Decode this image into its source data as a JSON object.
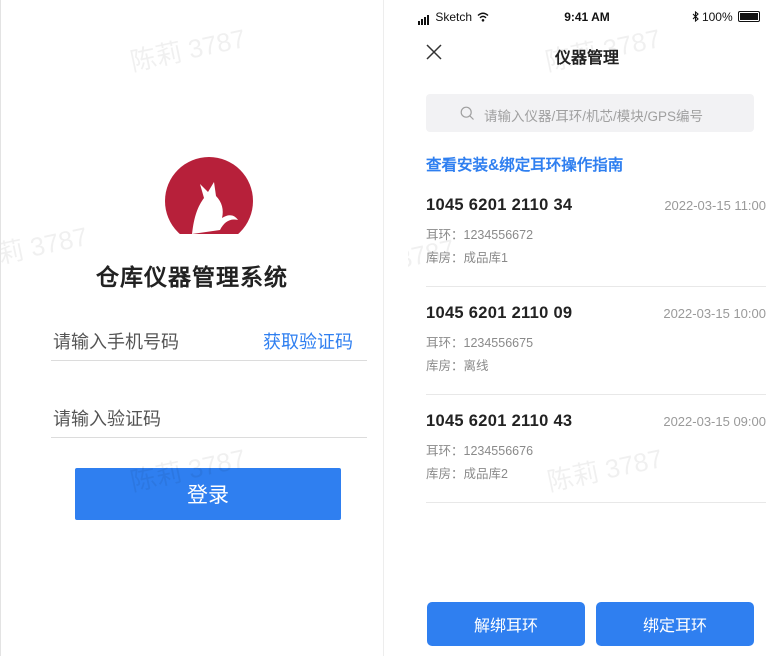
{
  "login": {
    "app_title": "仓库仪器管理系统",
    "phone_placeholder": "请输入手机号码",
    "get_code_label": "获取验证码",
    "code_placeholder": "请输入验证码",
    "login_label": "登录",
    "brand_color": "#b7203a"
  },
  "status_bar": {
    "carrier": "Sketch",
    "time": "9:41 AM",
    "battery": "100%"
  },
  "app": {
    "nav_title": "仪器管理",
    "search_placeholder": "请输入仪器/耳环/机芯/模块/GPS编号",
    "guide_link": "查看安装&绑定耳环操作指南",
    "devices": [
      {
        "number": "1045 6201 2110 34",
        "time": "2022-03-15 11:00",
        "ear": "耳环：1234556672",
        "room": "库房：成品库1"
      },
      {
        "number": "1045 6201 2110 09",
        "time": "2022-03-15 10:00",
        "ear": "耳环：1234556675",
        "room": "库房：离线"
      },
      {
        "number": "1045 6201 2110 43",
        "time": "2022-03-15 09:00",
        "ear": "耳环：1234556676",
        "room": "库房：成品库2"
      }
    ],
    "unbind_label": "解绑耳环",
    "bind_label": "绑定耳环",
    "accent_color": "#2f7ff0"
  },
  "watermark": "陈莉 3787"
}
